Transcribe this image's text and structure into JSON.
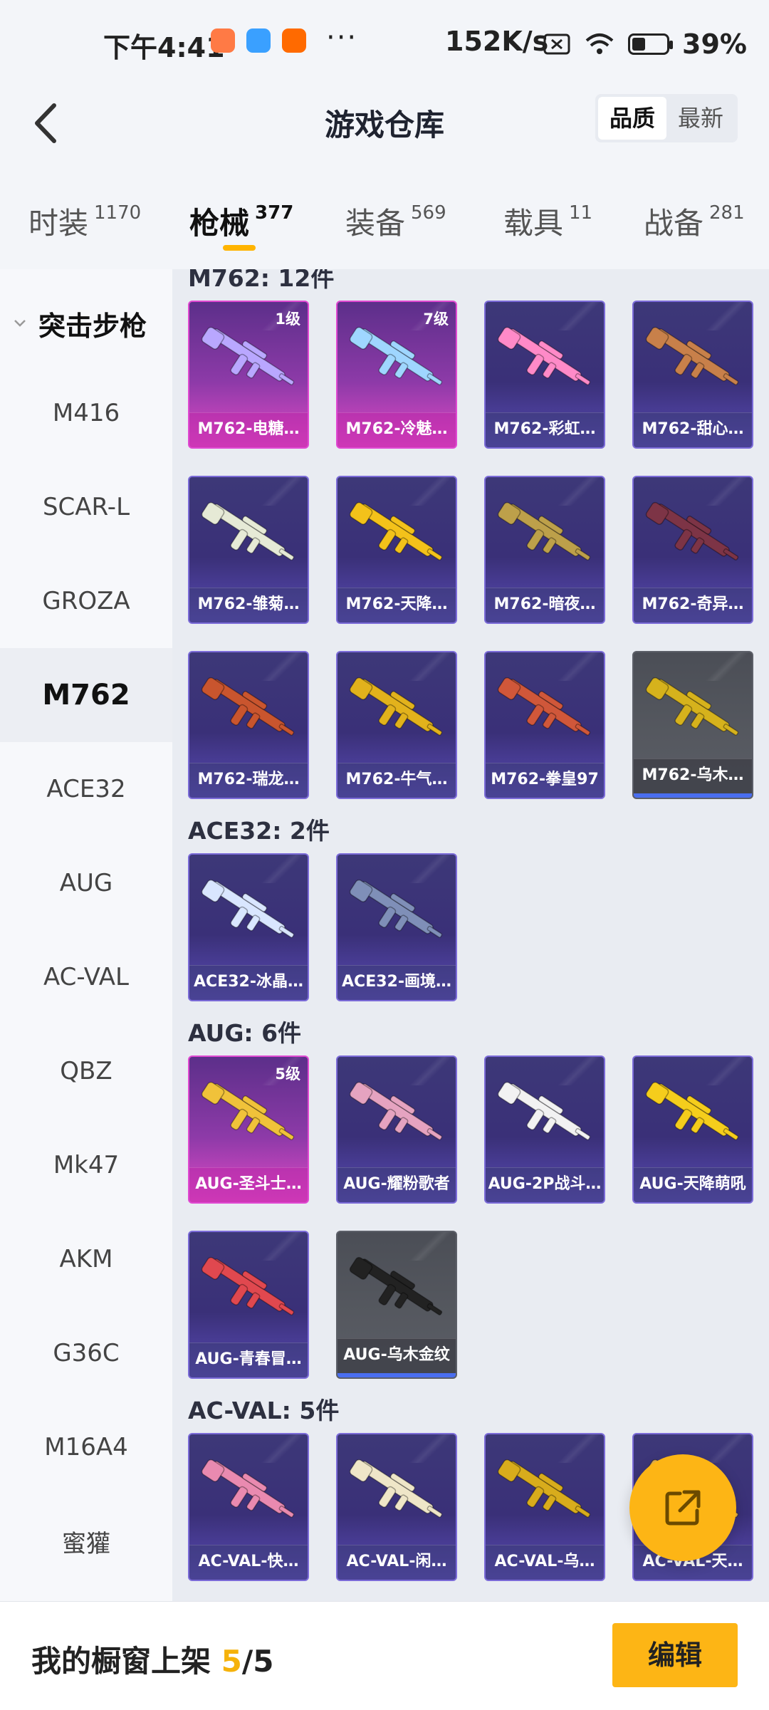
{
  "status_bar": {
    "time": "下午4:41",
    "dots": "···",
    "net_speed": "152K/s",
    "battery_pct": "39%",
    "battery_level": 0.39
  },
  "header": {
    "title": "游戏仓库",
    "sort_quality": "品质",
    "sort_newest": "最新"
  },
  "tabs": [
    {
      "label": "时装",
      "count": "1170"
    },
    {
      "label": "枪械",
      "count": "377"
    },
    {
      "label": "装备",
      "count": "569"
    },
    {
      "label": "载具",
      "count": "11"
    },
    {
      "label": "战备",
      "count": "281"
    }
  ],
  "sidebar": {
    "group": "突击步枪",
    "items": [
      "M416",
      "SCAR-L",
      "GROZA",
      "M762",
      "ACE32",
      "AUG",
      "AC-VAL",
      "QBZ",
      "Mk47",
      "AKM",
      "G36C",
      "M16A4",
      "蜜獾"
    ],
    "active": "M762"
  },
  "sections": [
    {
      "title": "M762: 12件",
      "items": [
        {
          "label": "M762-电糖…",
          "level": "1级",
          "rarity": "pink",
          "color": "#b9a7ff"
        },
        {
          "label": "M762-冷魅…",
          "level": "7级",
          "rarity": "pink",
          "color": "#9fd6ff"
        },
        {
          "label": "M762-彩虹…",
          "level": "",
          "rarity": "purple",
          "color": "#ff8ac8"
        },
        {
          "label": "M762-甜心…",
          "level": "",
          "rarity": "purple",
          "color": "#c8804a"
        },
        {
          "label": "M762-雏菊…",
          "level": "",
          "rarity": "purple",
          "color": "#e6ead6"
        },
        {
          "label": "M762-天降…",
          "level": "",
          "rarity": "purple",
          "color": "#f3c21a"
        },
        {
          "label": "M762-暗夜…",
          "level": "",
          "rarity": "purple",
          "color": "#bda04a"
        },
        {
          "label": "M762-奇异…",
          "level": "",
          "rarity": "purple",
          "color": "#7d3446"
        },
        {
          "label": "M762-瑞龙…",
          "level": "",
          "rarity": "purple",
          "color": "#c9552e"
        },
        {
          "label": "M762-牛气…",
          "level": "",
          "rarity": "purple",
          "color": "#e2b21c"
        },
        {
          "label": "M762-拳皇97",
          "level": "",
          "rarity": "purple",
          "color": "#d0573a"
        },
        {
          "label": "M762-乌木…",
          "level": "",
          "rarity": "gray",
          "color": "#d6b21c"
        }
      ]
    },
    {
      "title": "ACE32: 2件",
      "items": [
        {
          "label": "ACE32-冰晶…",
          "level": "",
          "rarity": "purple",
          "color": "#d9e6ff"
        },
        {
          "label": "ACE32-画境…",
          "level": "",
          "rarity": "purple",
          "color": "#7f8fb8"
        }
      ]
    },
    {
      "title": "AUG: 6件",
      "items": [
        {
          "label": "AUG-圣斗士…",
          "level": "5级",
          "rarity": "pink",
          "color": "#f0c23a"
        },
        {
          "label": "AUG-耀粉歌者",
          "level": "",
          "rarity": "purple",
          "color": "#e5a3c0"
        },
        {
          "label": "AUG-2P战斗…",
          "level": "",
          "rarity": "purple",
          "color": "#f2f2f2"
        },
        {
          "label": "AUG-天降萌吼",
          "level": "",
          "rarity": "purple",
          "color": "#f5cd1c"
        },
        {
          "label": "AUG-青春冒…",
          "level": "",
          "rarity": "purple",
          "color": "#e0484f"
        },
        {
          "label": "AUG-乌木金纹",
          "level": "",
          "rarity": "gray",
          "color": "#222222"
        }
      ]
    },
    {
      "title": "AC-VAL: 5件",
      "items": [
        {
          "label": "AC-VAL-快…",
          "level": "",
          "rarity": "purple",
          "color": "#e98ab0"
        },
        {
          "label": "AC-VAL-闲…",
          "level": "",
          "rarity": "purple",
          "color": "#efe6c8"
        },
        {
          "label": "AC-VAL-乌…",
          "level": "",
          "rarity": "purple",
          "color": "#d8ac1c"
        },
        {
          "label": "AC-VAL-天…",
          "level": "",
          "rarity": "purple",
          "color": "#e6b24a"
        }
      ]
    }
  ],
  "bottom": {
    "label": "我的橱窗上架",
    "current": "5",
    "total": "/5",
    "edit_button": "编辑"
  },
  "colors": {
    "accent": "#fdb515",
    "pink_rarity": "#e04ad2",
    "purple_rarity": "#6c5ce7"
  },
  "icons": {
    "back": "chevron-left-icon",
    "fab": "share-external-icon",
    "group": "chevron-down-icon"
  }
}
